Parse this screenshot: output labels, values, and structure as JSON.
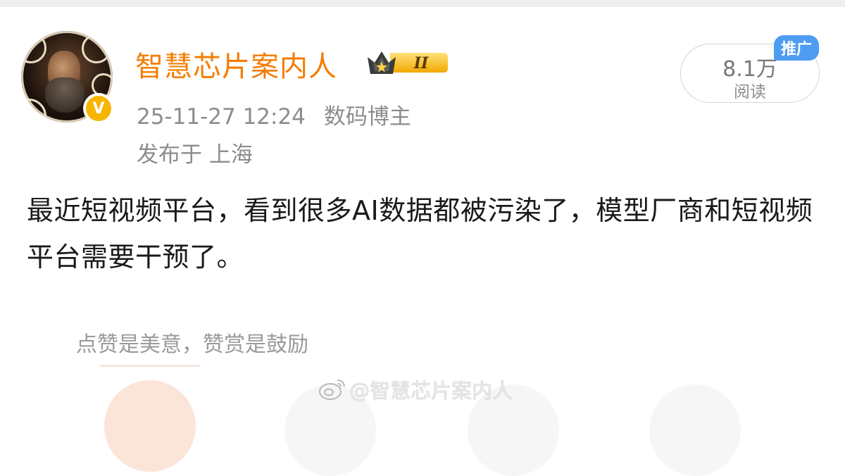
{
  "author": {
    "name": "智慧芯片案内人",
    "verified_mark": "V",
    "rank_badge": "II",
    "avatar_icon": "avatar-portrait"
  },
  "meta": {
    "timestamp": "25-11-27 12:24",
    "category": "数码博主",
    "location": "发布于 上海"
  },
  "stats": {
    "read_count": "8.1万",
    "read_label": "阅读",
    "promo_tag": "推广"
  },
  "post": {
    "text": "最近短视频平台，看到很多AI数据都被污染了，模型厂商和短视频平台需要干预了。"
  },
  "reward": {
    "text": "点赞是美意，赞赏是鼓励"
  },
  "watermark": {
    "text": "@智慧芯片案内人"
  },
  "colors": {
    "username": "#f57c00",
    "promo_tag": "#4d9df2",
    "verified": "#f7b500",
    "meta_text": "#8c8c8c"
  }
}
